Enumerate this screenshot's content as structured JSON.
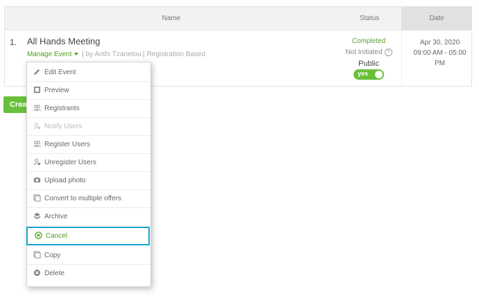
{
  "table": {
    "headers": {
      "name": "Name",
      "status": "Status",
      "date": "Date"
    },
    "row": {
      "number": "1.",
      "title": "All Hands Meeting",
      "manage_label": "Manage Event",
      "meta_by": "| by Anthi Tzanetou |",
      "meta_type": "Registration Based",
      "status_completed": "Completed",
      "status_initiated": "Not Initiated",
      "visibility_label": "Public",
      "toggle_label": "yes",
      "date_line1": "Apr 30, 2020",
      "date_line2": "09:00 AM - 05:00",
      "date_line3": "PM"
    }
  },
  "create_button": {
    "label": "Crea"
  },
  "menu": {
    "items": [
      {
        "label": "Edit Event",
        "icon": "pencil-icon",
        "disabled": false
      },
      {
        "label": "Preview",
        "icon": "preview-icon",
        "disabled": false
      },
      {
        "label": "Registrants",
        "icon": "users-icon",
        "disabled": false
      },
      {
        "label": "Notify Users",
        "icon": "user-notify-icon",
        "disabled": true
      },
      {
        "label": "Register Users",
        "icon": "users-icon",
        "disabled": false
      },
      {
        "label": "Unregister Users",
        "icon": "user-remove-icon",
        "disabled": false
      },
      {
        "label": "Upload photo",
        "icon": "camera-icon",
        "disabled": false
      },
      {
        "label": "Convert to multiple offers",
        "icon": "convert-icon",
        "disabled": false
      },
      {
        "label": "Archive",
        "icon": "archive-icon",
        "disabled": false
      },
      {
        "label": "Cancel",
        "icon": "cancel-icon",
        "disabled": false,
        "highlighted": true
      },
      {
        "label": "Copy",
        "icon": "copy-icon",
        "disabled": false
      },
      {
        "label": "Delete",
        "icon": "delete-icon",
        "disabled": false
      }
    ]
  },
  "colors": {
    "accent_green": "#6abf3a",
    "link_green": "#4a9e1a",
    "highlight_border": "#1aa3d6"
  }
}
